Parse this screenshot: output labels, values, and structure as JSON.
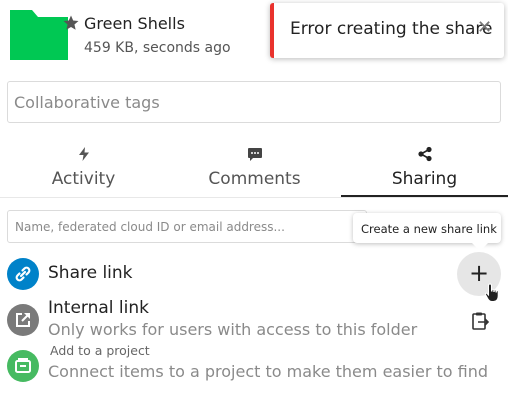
{
  "header": {
    "title": "Green Shells",
    "subtitle": "459 KB, seconds ago",
    "folder_color": "#00c853"
  },
  "toast": {
    "message": "Error creating the share",
    "close_glyph": "✕",
    "accent_color": "#e9322d"
  },
  "tags": {
    "placeholder": "Collaborative tags"
  },
  "tabs": [
    {
      "label": "Activity",
      "icon": "lightning-icon"
    },
    {
      "label": "Comments",
      "icon": "comment-icon"
    },
    {
      "label": "Sharing",
      "icon": "share-icon",
      "active": true
    }
  ],
  "share_search": {
    "placeholder": "Name, federated cloud ID or email address..."
  },
  "tooltip": {
    "text": "Create a new share link"
  },
  "share_link": {
    "title": "Share link",
    "add_glyph": "+",
    "color": "#0082c9"
  },
  "internal_link": {
    "title": "Internal link",
    "subtitle": "Only works for users with access to this folder",
    "color": "#7a7a7a"
  },
  "project": {
    "title": "Add to a project",
    "subtitle": "Connect items to a project to make them easier to find",
    "color": "#46ba61"
  }
}
